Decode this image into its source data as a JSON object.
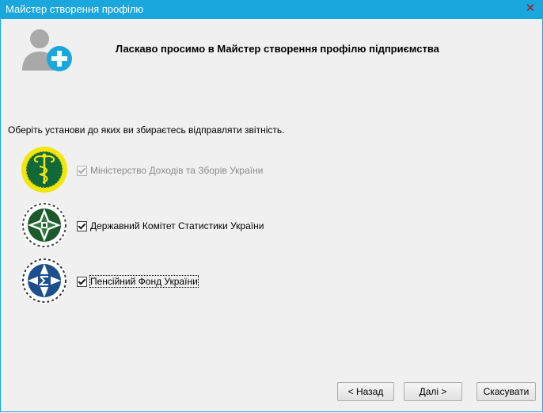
{
  "window": {
    "title": "Майстер створення профілю",
    "close_glyph": "✕"
  },
  "header": {
    "icon": "user-add-icon",
    "welcome": "Ласкаво просимо в Майстер створення профілю підприємства"
  },
  "prompt": "Оберіть установи до яких ви збираєтесь відправляти звітність.",
  "organizations": [
    {
      "label": "Міністерство Доходів та Зборів України",
      "checked": true,
      "enabled": false,
      "logo": "tax-ministry-emblem-icon"
    },
    {
      "label": "Державний Комітет Статистики України",
      "checked": true,
      "enabled": true,
      "logo": "statistics-committee-emblem-icon"
    },
    {
      "label": "Пенсійний Фонд України",
      "checked": true,
      "enabled": true,
      "focused": true,
      "logo": "pension-fund-emblem-icon"
    }
  ],
  "buttons": {
    "back": "< Назад",
    "next": "Далі >",
    "cancel": "Скасувати"
  },
  "colors": {
    "titlebar": "#1aa7dd",
    "background": "#f0f0f0"
  }
}
